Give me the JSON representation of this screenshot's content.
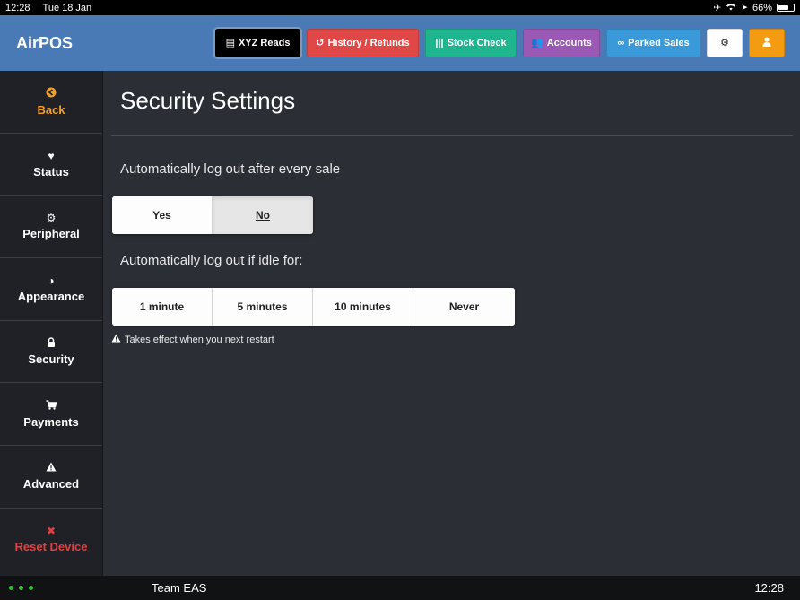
{
  "status_bar": {
    "time": "12:28",
    "date": "Tue 18 Jan",
    "battery": "66%",
    "battery_level": 0.66
  },
  "header": {
    "app_name": "AirPOS",
    "buttons": [
      {
        "label": "XYZ Reads",
        "icon": "list-icon",
        "color": "#000000"
      },
      {
        "label": "History / Refunds",
        "icon": "history-icon",
        "color": "#e04848"
      },
      {
        "label": "Stock Check",
        "icon": "barcode-icon",
        "color": "#1fb58f"
      },
      {
        "label": "Accounts",
        "icon": "users-icon",
        "color": "#9b59b6"
      },
      {
        "label": "Parked Sales",
        "icon": "binoculars-icon",
        "color": "#3a9ad9"
      },
      {
        "label": "",
        "icon": "gear-icon",
        "color": "#ffffff"
      },
      {
        "label": "",
        "icon": "user-icon",
        "color": "#f39c12"
      }
    ]
  },
  "sidebar": {
    "items": [
      {
        "label": "Back",
        "icon": "back-arrow-icon"
      },
      {
        "label": "Status",
        "icon": "heartbeat-icon"
      },
      {
        "label": "Peripheral",
        "icon": "gear-icon"
      },
      {
        "label": "Appearance",
        "icon": "contrast-icon"
      },
      {
        "label": "Security",
        "icon": "lock-icon"
      },
      {
        "label": "Payments",
        "icon": "cart-icon"
      },
      {
        "label": "Advanced",
        "icon": "warning-icon"
      },
      {
        "label": "Reset Device",
        "icon": "close-icon"
      }
    ],
    "selected": "Security"
  },
  "main": {
    "title": "Security Settings",
    "logout_after_sale": {
      "label": "Automatically log out after every sale",
      "options": [
        "Yes",
        "No"
      ],
      "selected": "No"
    },
    "logout_idle": {
      "label": "Automatically log out if idle for:",
      "options": [
        "1 minute",
        "5 minutes",
        "10 minutes",
        "Never"
      ],
      "selected": "Never"
    },
    "note": "Takes effect when you next restart"
  },
  "bottom_bar": {
    "team": "Team EAS",
    "time": "12:28"
  }
}
